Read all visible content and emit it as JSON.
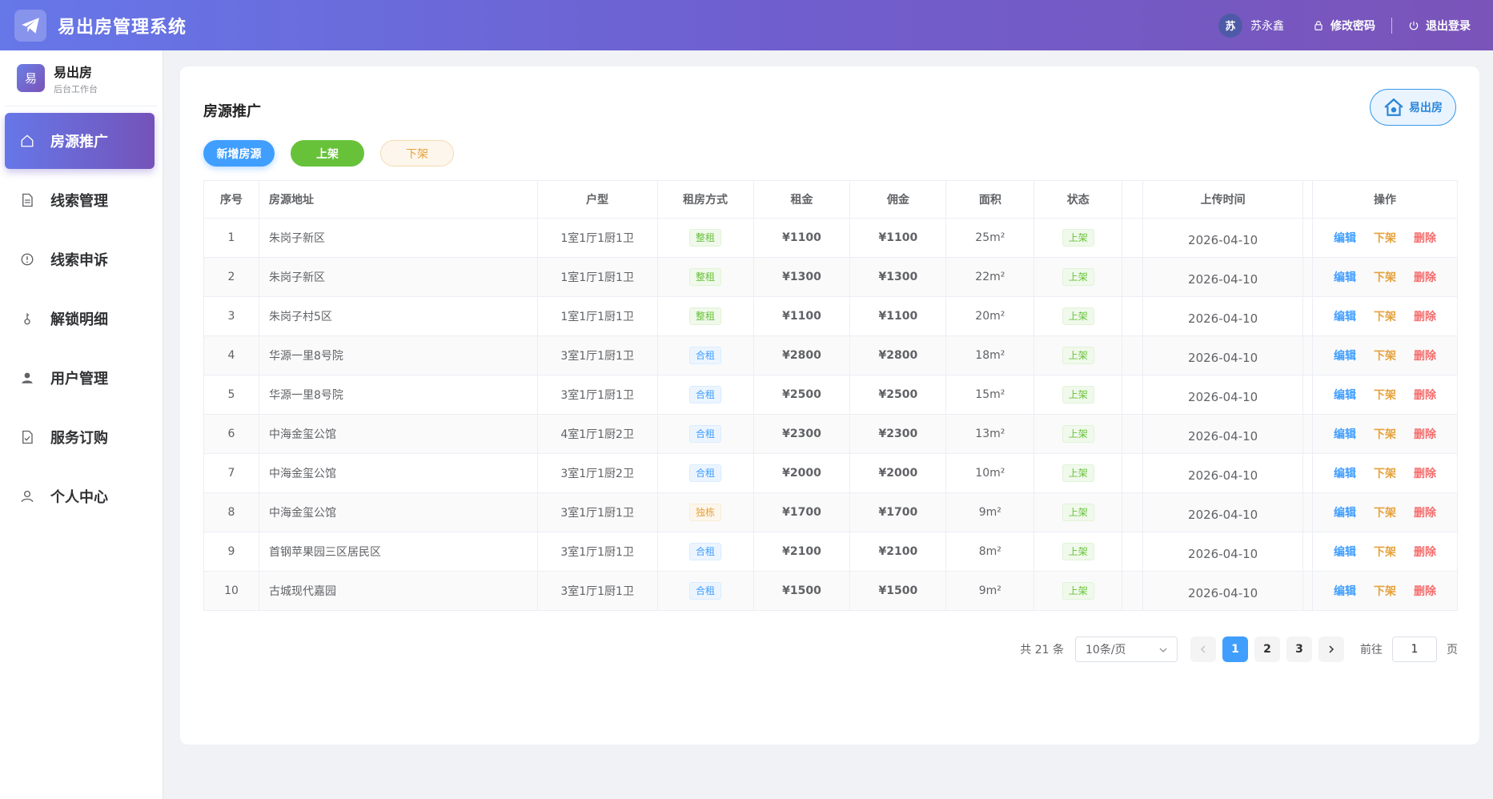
{
  "header": {
    "title": "易出房管理系统",
    "user_avatar_text": "苏",
    "user_name": "苏永鑫",
    "change_password": "修改密码",
    "logout": "退出登录"
  },
  "sidebar": {
    "brand_logo_text": "易",
    "brand_name": "易出房",
    "brand_sub": "后台工作台",
    "items": [
      {
        "label": "房源推广",
        "icon": "home-icon",
        "active": true
      },
      {
        "label": "线索管理",
        "icon": "document-icon"
      },
      {
        "label": "线索申诉",
        "icon": "alert-circle-icon"
      },
      {
        "label": "解锁明细",
        "icon": "key-icon"
      },
      {
        "label": "用户管理",
        "icon": "user-filled-icon"
      },
      {
        "label": "服务订购",
        "icon": "checklist-icon"
      },
      {
        "label": "个人中心",
        "icon": "user-outline-icon"
      }
    ]
  },
  "main": {
    "title": "房源推广",
    "brand_pill": "易出房",
    "buttons": {
      "add": "新增房源",
      "up": "上架",
      "down": "下架"
    },
    "columns": [
      "序号",
      "房源地址",
      "户型",
      "租房方式",
      "租金",
      "佣金",
      "面积",
      "状态",
      "上传时间",
      "操作"
    ],
    "actions": {
      "edit": "编辑",
      "down": "下架",
      "delete": "删除"
    },
    "rows": [
      {
        "no": "1",
        "address": "朱岗子新区",
        "layout": "1室1厅1厨1卫",
        "mode": "整租",
        "rent": "¥1100",
        "commission": "¥1100",
        "area": "25m²",
        "status": "上架",
        "uploaded": "2026-04-10"
      },
      {
        "no": "2",
        "address": "朱岗子新区",
        "layout": "1室1厅1厨1卫",
        "mode": "整租",
        "rent": "¥1300",
        "commission": "¥1300",
        "area": "22m²",
        "status": "上架",
        "uploaded": "2026-04-10"
      },
      {
        "no": "3",
        "address": "朱岗子村5区",
        "layout": "1室1厅1厨1卫",
        "mode": "整租",
        "rent": "¥1100",
        "commission": "¥1100",
        "area": "20m²",
        "status": "上架",
        "uploaded": "2026-04-10"
      },
      {
        "no": "4",
        "address": "华源一里8号院",
        "layout": "3室1厅1厨1卫",
        "mode": "合租",
        "rent": "¥2800",
        "commission": "¥2800",
        "area": "18m²",
        "status": "上架",
        "uploaded": "2026-04-10"
      },
      {
        "no": "5",
        "address": "华源一里8号院",
        "layout": "3室1厅1厨1卫",
        "mode": "合租",
        "rent": "¥2500",
        "commission": "¥2500",
        "area": "15m²",
        "status": "上架",
        "uploaded": "2026-04-10"
      },
      {
        "no": "6",
        "address": "中海金玺公馆",
        "layout": "4室1厅1厨2卫",
        "mode": "合租",
        "rent": "¥2300",
        "commission": "¥2300",
        "area": "13m²",
        "status": "上架",
        "uploaded": "2026-04-10"
      },
      {
        "no": "7",
        "address": "中海金玺公馆",
        "layout": "3室1厅1厨2卫",
        "mode": "合租",
        "rent": "¥2000",
        "commission": "¥2000",
        "area": "10m²",
        "status": "上架",
        "uploaded": "2026-04-10"
      },
      {
        "no": "8",
        "address": "中海金玺公馆",
        "layout": "3室1厅1厨1卫",
        "mode": "独栋",
        "rent": "¥1700",
        "commission": "¥1700",
        "area": "9m²",
        "status": "上架",
        "uploaded": "2026-04-10"
      },
      {
        "no": "9",
        "address": "首钢苹果园三区居民区",
        "layout": "3室1厅1厨1卫",
        "mode": "合租",
        "rent": "¥2100",
        "commission": "¥2100",
        "area": "8m²",
        "status": "上架",
        "uploaded": "2026-04-10"
      },
      {
        "no": "10",
        "address": "古城现代嘉园",
        "layout": "3室1厅1厨1卫",
        "mode": "合租",
        "rent": "¥1500",
        "commission": "¥1500",
        "area": "9m²",
        "status": "上架",
        "uploaded": "2026-04-10"
      }
    ]
  },
  "pagination": {
    "total": "共 21 条",
    "page_size": "10条/页",
    "pages": [
      "1",
      "2",
      "3"
    ],
    "current": "1",
    "goto_prefix": "前往",
    "goto_value": "1",
    "goto_suffix": "页"
  },
  "colors": {
    "header_gradient_start": "#6677e8",
    "header_gradient_end": "#7a54b9",
    "primary": "#409eff",
    "success": "#67c23a",
    "warning": "#e6a23c",
    "danger": "#f56c6c"
  }
}
